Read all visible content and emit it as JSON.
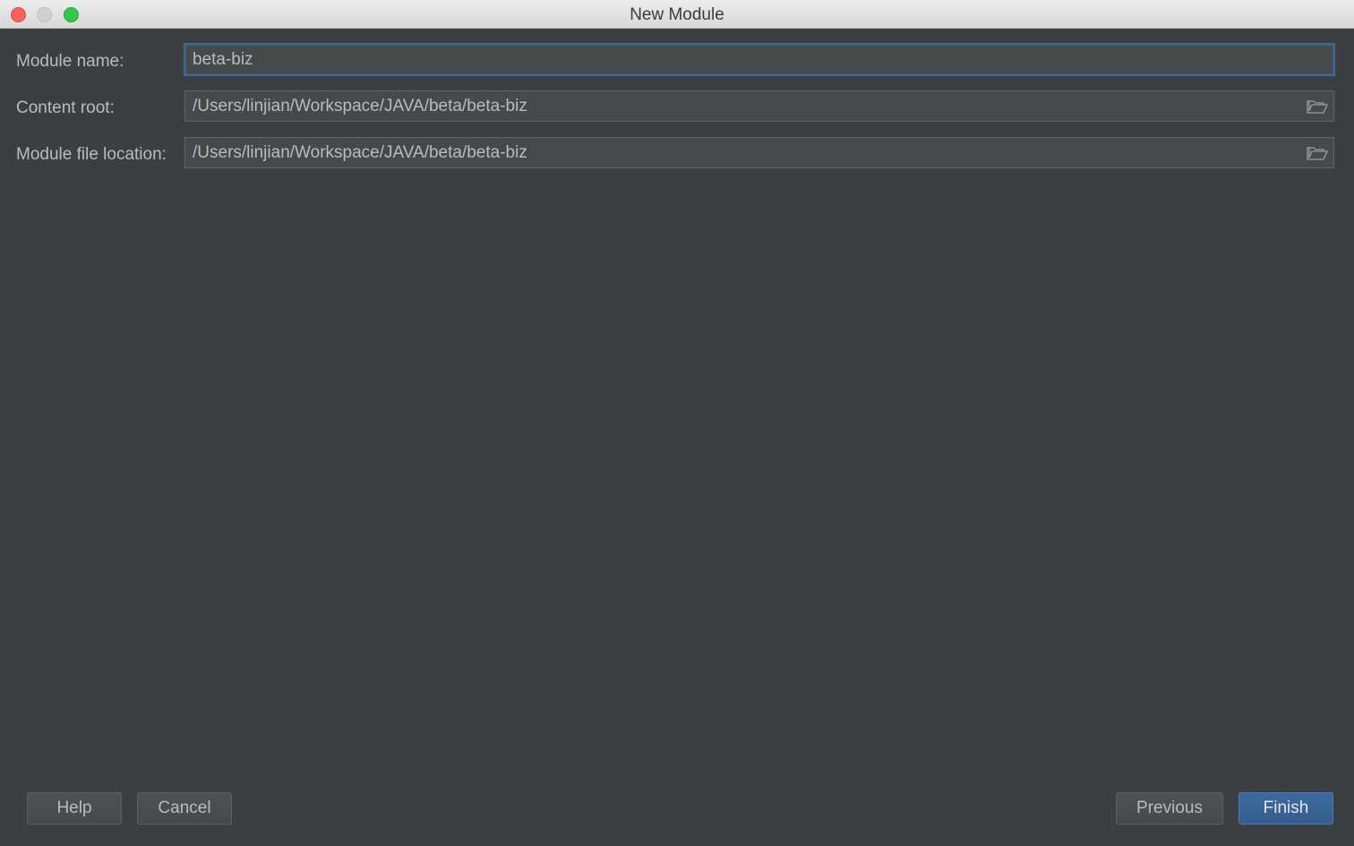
{
  "window": {
    "title": "New Module"
  },
  "form": {
    "module_name": {
      "label": "Module name:",
      "value": "beta-biz"
    },
    "content_root": {
      "label": "Content root:",
      "value": "/Users/linjian/Workspace/JAVA/beta/beta-biz",
      "browse_icon": "folder-open-icon"
    },
    "module_file_location": {
      "label": "Module file location:",
      "value": "/Users/linjian/Workspace/JAVA/beta/beta-biz",
      "browse_icon": "folder-open-icon"
    }
  },
  "buttons": {
    "help": "Help",
    "cancel": "Cancel",
    "previous": "Previous",
    "finish": "Finish"
  },
  "colors": {
    "background": "#3c3f41",
    "field_background": "#45494a",
    "focus_border": "#3d6185",
    "default_button": "#365d8c",
    "text": "#bbbbbb"
  }
}
